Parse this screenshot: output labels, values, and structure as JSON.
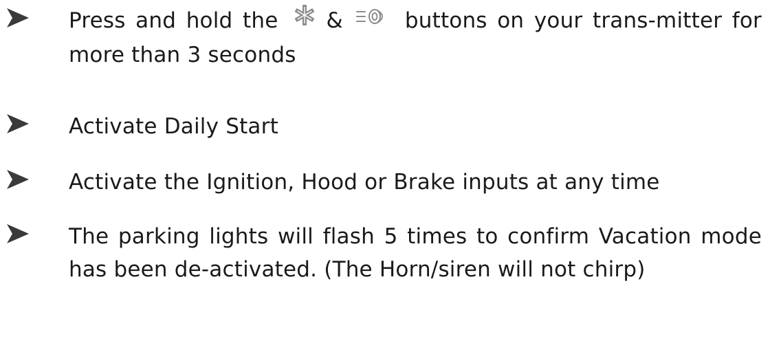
{
  "instructions": {
    "items": [
      {
        "before_icons": "Press and hold the",
        "icon_1": "snowflake-asterisk-icon",
        "ampersand": "&",
        "icon_2": "headlight-icon",
        "after_icons": "buttons on your trans-mitter for more than 3 seconds"
      },
      {
        "text": "Activate Daily Start"
      },
      {
        "text": "Activate the Ignition, Hood or Brake inputs at any time"
      },
      {
        "text": "The parking lights will flash 5 times to confirm Vacation mode has been de-activated. (The Horn/siren will not chirp)"
      }
    ]
  },
  "colors": {
    "text": "#1a1a1a",
    "bullet": "#3a3a3a",
    "icon_gray": "#8c8c8c"
  }
}
